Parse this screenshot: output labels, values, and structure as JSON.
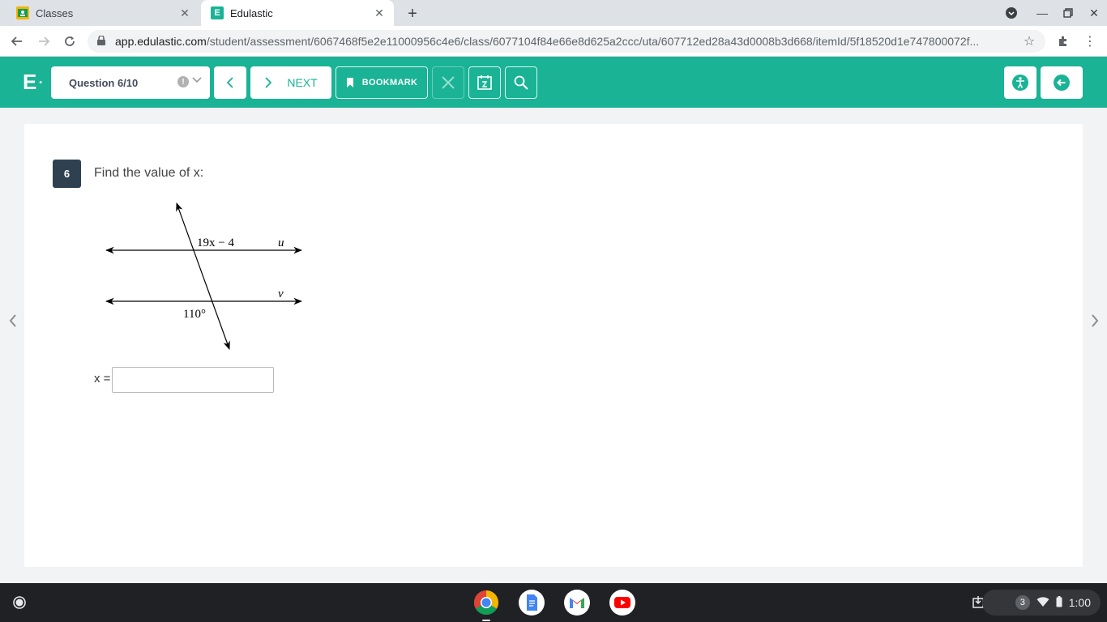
{
  "browser": {
    "tabs": [
      {
        "title": "Classes",
        "favicon": "classroom-icon",
        "active": false
      },
      {
        "title": "Edulastic",
        "favicon": "edulastic-icon",
        "active": true
      }
    ],
    "url_host": "app.edulastic.com",
    "url_path": "/student/assessment/6067468f5e2e11000956c4e6/class/6077104f84e66e8d625a2ccc/uta/607712ed28a43d0008b3d668/itemId/5f18520d1e747800072f..."
  },
  "app": {
    "logo": "E",
    "question_selector": "Question 6/10",
    "next_label": "NEXT",
    "bookmark_label": "BOOKMARK",
    "accent_color": "#1ab395"
  },
  "question": {
    "number": "6",
    "prompt": "Find the value of x:",
    "figure": {
      "angle_top": "19x − 4",
      "angle_bottom": "110°",
      "line_top": "u",
      "line_bottom": "v"
    },
    "answer_label": "x =",
    "answer_value": ""
  },
  "shelf": {
    "notification_count": "3",
    "time": "1:00"
  }
}
